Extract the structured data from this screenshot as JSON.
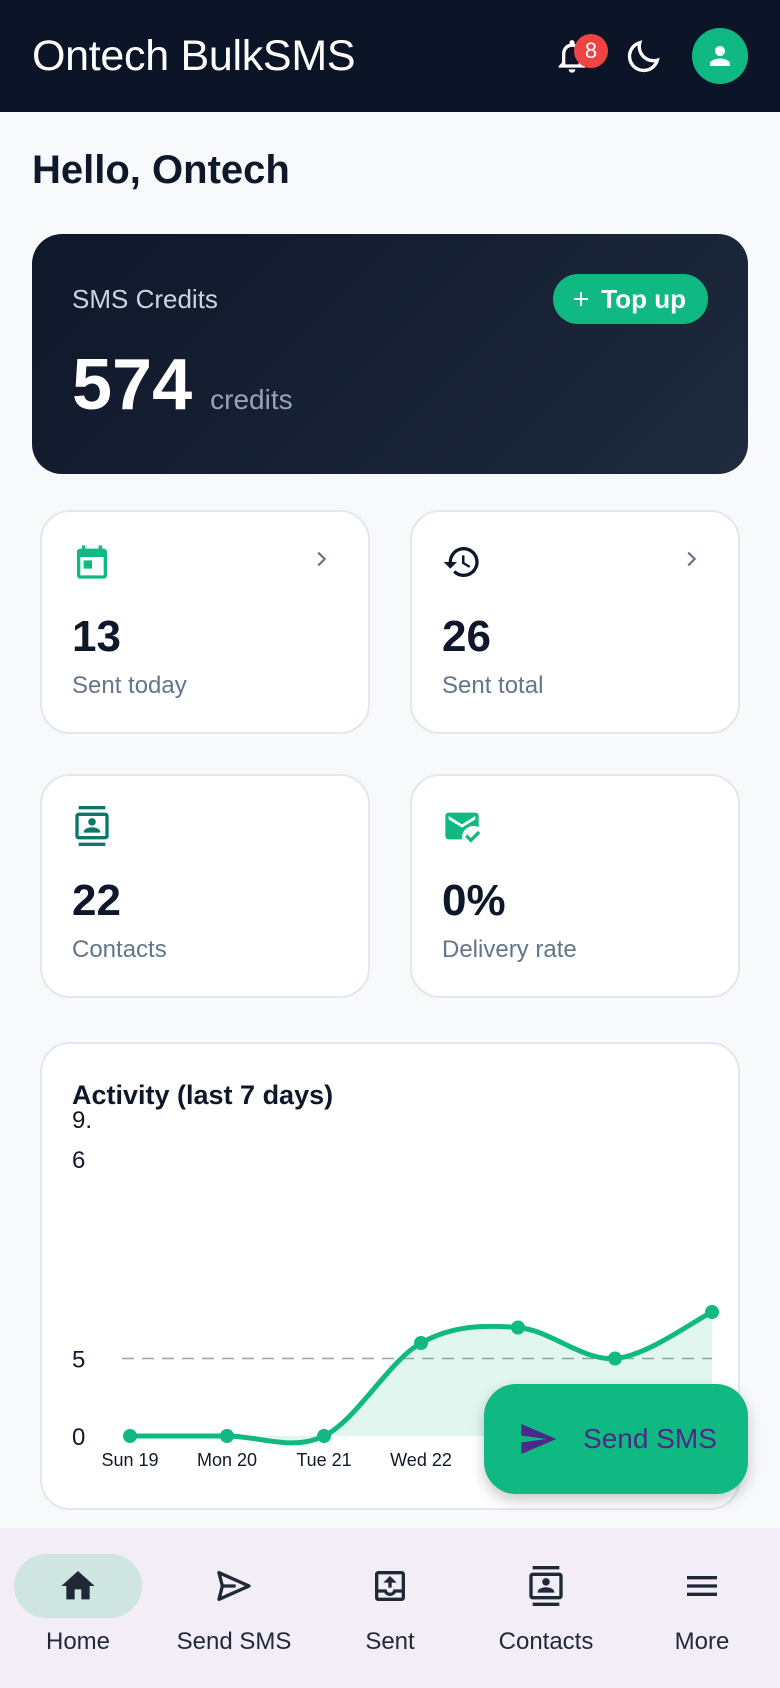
{
  "appbar": {
    "title": "Ontech BulkSMS",
    "notification_count": "8",
    "icons": [
      "bell-icon",
      "moon-icon",
      "person-icon"
    ]
  },
  "greeting": "Hello, Ontech",
  "credits": {
    "label": "SMS Credits",
    "value": "574",
    "unit": "credits",
    "topup_label": "Top up"
  },
  "stats": [
    {
      "value": "13",
      "label": "Sent today",
      "icon": "calendar-icon"
    },
    {
      "value": "26",
      "label": "Sent total",
      "icon": "history-icon"
    },
    {
      "value": "22",
      "label": "Contacts",
      "icon": "contacts-icon"
    },
    {
      "value": "0%",
      "label": "Delivery rate",
      "icon": "mark-email-read-icon"
    }
  ],
  "fab": {
    "label": "Send SMS"
  },
  "nav": [
    {
      "label": "Home",
      "icon": "home-icon",
      "active": true
    },
    {
      "label": "Send SMS",
      "icon": "send-icon",
      "active": false
    },
    {
      "label": "Sent",
      "icon": "outbox-icon",
      "active": false
    },
    {
      "label": "Contacts",
      "icon": "contacts-icon",
      "active": false
    },
    {
      "label": "More",
      "icon": "menu-icon",
      "active": false
    }
  ],
  "colors": {
    "appbar": "#0c1427",
    "accent": "#10b981",
    "badge": "#ef4444",
    "fab_text": "#4c2a8a",
    "nav_bg": "#f3edf7",
    "nav_active": "#cfe6e0"
  },
  "chart_data": {
    "type": "line",
    "title": "Activity (last 7 days)",
    "categories": [
      "Sun 19",
      "Mon 20",
      "Tue 21",
      "Wed 22"
    ],
    "values": [
      0,
      0,
      0,
      6,
      7,
      5,
      8
    ],
    "ylim": [
      0,
      9.6
    ],
    "y_ticks": [
      "0",
      "5",
      "6"
    ],
    "y_top_label": "9.",
    "reference_line": 5,
    "smooth": true,
    "area_fill": true,
    "grid": false
  }
}
